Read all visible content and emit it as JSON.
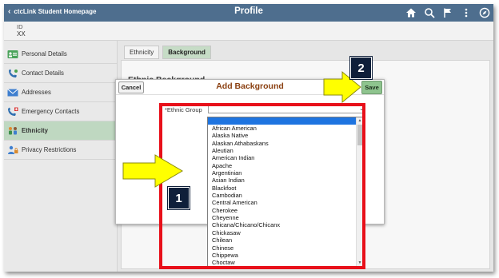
{
  "header": {
    "back_label": "ctcLink Student Homepage",
    "title": "Profile",
    "icons": [
      "home-icon",
      "search-icon",
      "flag-icon",
      "more-vertical-icon",
      "compass-icon"
    ]
  },
  "id_bar": {
    "label": "ID",
    "value": "XX"
  },
  "sidebar": {
    "items": [
      {
        "label": "Personal Details",
        "icon": "id-card-icon"
      },
      {
        "label": "Contact Details",
        "icon": "phone-icon"
      },
      {
        "label": "Addresses",
        "icon": "envelope-icon"
      },
      {
        "label": "Emergency Contacts",
        "icon": "emergency-phone-icon"
      },
      {
        "label": "Ethnicity",
        "icon": "people-icon",
        "selected": true
      },
      {
        "label": "Privacy Restrictions",
        "icon": "person-lock-icon"
      }
    ]
  },
  "tabs": [
    {
      "label": "Ethnicity",
      "active": false
    },
    {
      "label": "Background",
      "active": true
    }
  ],
  "section_heading": "Ethnic Background",
  "modal": {
    "cancel_label": "Cancel",
    "title": "Add Background",
    "save_label": "Save",
    "field_label": "*Ethnic Group",
    "field_value": ""
  },
  "dropdown": {
    "options": [
      "African American",
      "Alaska Native",
      "Alaskan Athabaskans",
      "Aleutian",
      "American Indian",
      "Apache",
      "Argentinian",
      "Asian Indian",
      "Blackfoot",
      "Cambodian",
      "Central American",
      "Cherokee",
      "Cheyenne",
      "Chicana/Chicano/Chicanx",
      "Chickasaw",
      "Chilean",
      "Chinese",
      "Chippewa",
      "Choctaw"
    ]
  },
  "annotations": {
    "step1": "1",
    "step2": "2"
  },
  "colors": {
    "banner": "#4e6e8e",
    "selected_nav": "#bfd8c1",
    "active_tab": "#c6dcc6",
    "save_button": "#8ec48e",
    "modal_title": "#8a3f10",
    "highlight_box": "#e8101a",
    "arrow": "#ffff00",
    "badge": "#0f1f3a",
    "selected_option": "#1e74e0"
  }
}
